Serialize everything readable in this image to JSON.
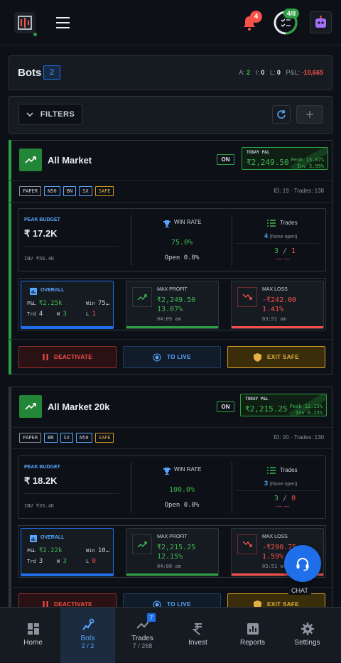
{
  "header": {
    "notifications": "4",
    "tasks_progress": "4/8",
    "tasks_fraction": 0.5
  },
  "summary": {
    "title": "Bots",
    "count": "2",
    "a_label": "A:",
    "a_value": "2",
    "i_label": "I:",
    "i_value": "0",
    "l_label": "L:",
    "l_value": "0",
    "pl_label": "P&L:",
    "pl_value": "-10,665"
  },
  "filters": {
    "label": "FILTERS"
  },
  "bots": [
    {
      "name": "All Market",
      "status": "ON",
      "today_label": "TODAY P&L",
      "today_value": "₹2,249.50",
      "peak_line": "Peak 13.07%",
      "inv_line": "Inv  3.99%",
      "tags": [
        "PAPER",
        "N50",
        "BN",
        "SX",
        "SAFE"
      ],
      "id_line": "ID: 19 · Trades: 138",
      "peak_label": "PEAK BUDGET",
      "peak_value": "₹  17.2K",
      "inv_value": "INV ₹56.4K",
      "winrate_label": "WIN RATE",
      "winrate_value": "75.0%",
      "open_value": "Open 0.0%",
      "trades_label": "Trades",
      "trades_count": "4",
      "trades_open": "(None open)",
      "wins": "3",
      "losses": "1",
      "dashes": "— —",
      "overall_label": "OVERALL",
      "ov_pl_label": "P&L",
      "ov_pl": "₹2.25k",
      "ov_win_label": "Win",
      "ov_win": "75…",
      "ov_trd_label": "Trd",
      "ov_trd": "4",
      "ov_w_label": "W",
      "ov_w": "3",
      "ov_l_label": "L",
      "ov_l": "1",
      "maxp_label": "MAX PROFIT",
      "maxp_v1": "₹2,249.50",
      "maxp_v2": "13.07%",
      "maxp_time": "04:09 am",
      "maxl_label": "MAX LOSS",
      "maxl_v1": "-₹242.00",
      "maxl_v2": "1.41%",
      "maxl_time": "03:51 am",
      "btn_deactivate": "DEACTIVATE",
      "btn_live": "TO LIVE",
      "btn_exit": "EXIT SAFE"
    },
    {
      "name": "All Market 20k",
      "status": "ON",
      "today_label": "TODAY P&L",
      "today_value": "₹2,215.25",
      "peak_line": "Peak 12.15%",
      "inv_line": "Inv  6.25%",
      "tags": [
        "PAPER",
        "BN",
        "SX",
        "N50",
        "SAFE"
      ],
      "id_line": "ID: 20 · Trades: 130",
      "peak_label": "PEAK BUDGET",
      "peak_value": "₹  18.2K",
      "inv_value": "INV ₹35.4K",
      "winrate_label": "WIN RATE",
      "winrate_value": "100.0%",
      "open_value": "Open 0.0%",
      "trades_label": "Trades",
      "trades_count": "3",
      "trades_open": "(None open)",
      "wins": "3",
      "losses": "0",
      "dashes": "— —",
      "overall_label": "OVERALL",
      "ov_pl_label": "P&L",
      "ov_pl": "₹2.22k",
      "ov_win_label": "Win",
      "ov_win": "10…",
      "ov_trd_label": "Trd",
      "ov_trd": "3",
      "ov_w_label": "W",
      "ov_w": "3",
      "ov_l_label": "L",
      "ov_l": "0",
      "maxp_label": "MAX PROFIT",
      "maxp_v1": "₹2,215.25",
      "maxp_v2": "12.15%",
      "maxp_time": "04:08 am",
      "maxl_label": "MAX LOSS",
      "maxl_v1": "-₹290.75",
      "maxl_v2": "1.59%",
      "maxl_time": "03:51 am",
      "btn_deactivate": "DEACTIVATE",
      "btn_live": "TO LIVE",
      "btn_exit": "EXIT SAFE"
    }
  ],
  "chat": {
    "label": "CHAT"
  },
  "nav": [
    {
      "label": "Home",
      "icon": "dashboard-icon"
    },
    {
      "label": "Bots",
      "icon": "robot-icon",
      "count": "2 / 2"
    },
    {
      "label": "Trades",
      "icon": "trending-icon",
      "count": "7 / 268",
      "badge": "7"
    },
    {
      "label": "Invest",
      "icon": "rupee-icon"
    },
    {
      "label": "Reports",
      "icon": "chart-icon"
    },
    {
      "label": "Settings",
      "icon": "gear-icon"
    }
  ]
}
